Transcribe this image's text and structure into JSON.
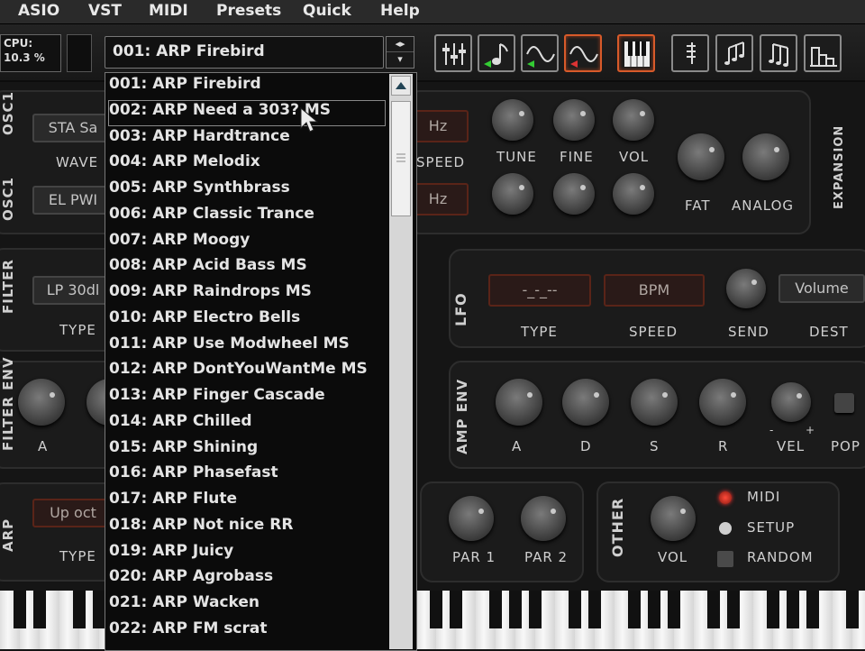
{
  "menu": [
    "ASIO",
    "VST",
    "MIDI",
    "Presets",
    "Quick",
    "Help"
  ],
  "cpu": {
    "label": "CPU:",
    "value": "10.3 %"
  },
  "preset": {
    "current": "001: ARP Firebird"
  },
  "presets_list": [
    "001: ARP Firebird",
    "002: ARP Need a 303? MS",
    "003: ARP Hardtrance",
    "004: ARP Melodix",
    "005: ARP Synthbrass",
    "006: ARP Classic Trance",
    "007: ARP Moogy",
    "008: ARP Acid Bass MS",
    "009: ARP Raindrops MS",
    "010: ARP Electro Bells",
    "011: ARP Use Modwheel MS",
    "012: ARP DontYouWantMe MS",
    "013: ARP Finger Cascade",
    "014: ARP Chilled",
    "015: ARP Shining",
    "016: ARP Phasefast",
    "017: ARP Flute",
    "018: ARP Not nice RR",
    "019: ARP Juicy",
    "020: ARP Agrobass",
    "021: ARP Wacken",
    "022: ARP FM scrat"
  ],
  "osc": {
    "osc1_tag": "OSC1",
    "osc2_tag": "OSC1",
    "osc1_wave": "STA Sa",
    "osc2_wave": "EL PWI",
    "wave_label": "WAVE",
    "hz1": "Hz",
    "hz2": "Hz",
    "speed_label": "SPEED",
    "knob_labels": [
      "TUNE",
      "FINE",
      "VOL"
    ],
    "fat_label": "FAT",
    "analog_label": "ANALOG",
    "expansion_label": "EXPANSION"
  },
  "filter": {
    "tag": "FILTER",
    "type_value": "LP 30dl",
    "type_label": "TYPE"
  },
  "filter_env": {
    "tag": "FILTER ENV",
    "a_label": "A"
  },
  "lfo": {
    "tag": "LFO",
    "type_value": "-_-_--",
    "speed_value": "BPM",
    "dest_value": "Volume",
    "labels": [
      "TYPE",
      "SPEED",
      "SEND",
      "DEST"
    ]
  },
  "amp_env": {
    "tag": "AMP ENV",
    "labels": [
      "A",
      "D",
      "S",
      "R",
      "VEL",
      "POP"
    ],
    "vel_minus": "-",
    "vel_plus": "+"
  },
  "arp": {
    "tag": "ARP",
    "type_value": "Up oct",
    "type_label": "TYPE",
    "par1": "PAR 1",
    "par2": "PAR 2"
  },
  "other": {
    "tag": "OTHER",
    "vol_label": "VOL",
    "midi_label": "MIDI",
    "setup_label": "SETUP",
    "random_label": "RANDOM"
  },
  "colors": {
    "accent": "#d85a2a",
    "panel": "#1b1b1b",
    "display_red": "#5a2418"
  }
}
